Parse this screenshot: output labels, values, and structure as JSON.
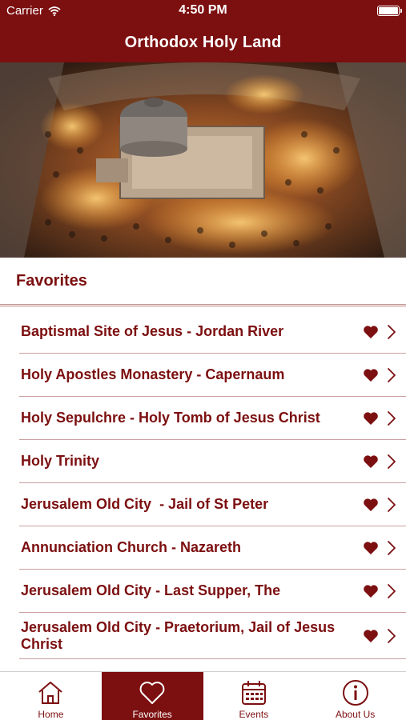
{
  "status_bar": {
    "carrier": "Carrier",
    "time": "4:50 PM"
  },
  "header": {
    "title": "Orthodox Holy Land"
  },
  "section": {
    "title": "Favorites"
  },
  "favorites": [
    {
      "label": "Baptismal Site of Jesus - Jordan River"
    },
    {
      "label": "Holy Apostles Monastery - Capernaum"
    },
    {
      "label": "Holy Sepulchre - Holy Tomb of Jesus Christ"
    },
    {
      "label": "Holy Trinity"
    },
    {
      "label": "Jerusalem Old City  - Jail of St Peter"
    },
    {
      "label": "Annunciation Church - Nazareth"
    },
    {
      "label": "Jerusalem Old City - Last Supper, The"
    },
    {
      "label": "Jerusalem Old City - Praetorium, Jail of Jesus Christ"
    }
  ],
  "tabs": [
    {
      "label": "Home",
      "icon": "home-icon"
    },
    {
      "label": "Favorites",
      "icon": "heart-icon",
      "active": true
    },
    {
      "label": "Events",
      "icon": "calendar-icon"
    },
    {
      "label": "About Us",
      "icon": "info-icon"
    }
  ],
  "colors": {
    "brand": "#7c0f10",
    "divider": "#c9a0a0",
    "background": "#ffffff"
  }
}
